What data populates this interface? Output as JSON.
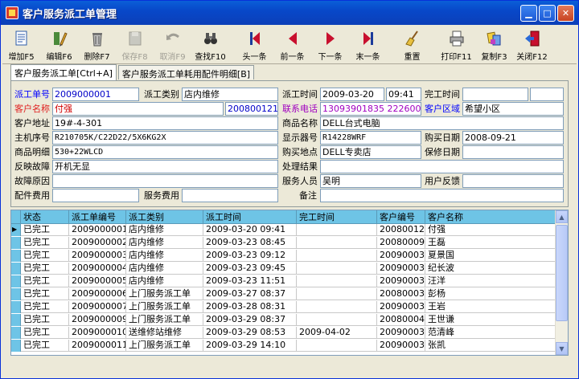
{
  "window": {
    "title": "客户服务派工单管理"
  },
  "toolbar": [
    {
      "key": "add",
      "label": "增加F5",
      "icon": "document-add-icon",
      "disabled": false
    },
    {
      "key": "edit",
      "label": "编辑F6",
      "icon": "edit-pencil-icon",
      "disabled": false
    },
    {
      "key": "delete",
      "label": "删除F7",
      "icon": "trash-icon",
      "disabled": false
    },
    {
      "key": "save",
      "label": "保存F8",
      "icon": "save-icon",
      "disabled": true
    },
    {
      "key": "cancel",
      "label": "取消F9",
      "icon": "undo-icon",
      "disabled": true
    },
    {
      "key": "find",
      "label": "查找F10",
      "icon": "binoculars-icon",
      "disabled": false
    },
    {
      "key": "first",
      "label": "头一条",
      "icon": "first-record-icon",
      "disabled": false
    },
    {
      "key": "prev",
      "label": "前一条",
      "icon": "prev-record-icon",
      "disabled": false
    },
    {
      "key": "next",
      "label": "下一条",
      "icon": "next-record-icon",
      "disabled": false
    },
    {
      "key": "last",
      "label": "末一条",
      "icon": "last-record-icon",
      "disabled": false
    },
    {
      "key": "reset",
      "label": "重置",
      "icon": "broom-icon",
      "disabled": false
    },
    {
      "key": "print",
      "label": "打印F11",
      "icon": "printer-icon",
      "disabled": false
    },
    {
      "key": "copy",
      "label": "复制F3",
      "icon": "copy-icon",
      "disabled": false
    },
    {
      "key": "close",
      "label": "关闭F12",
      "icon": "exit-door-icon",
      "disabled": false
    }
  ],
  "tabs": [
    {
      "label": "客户服务派工单[Ctrl+A]"
    },
    {
      "label": "客户服务派工单耗用配件明细[B]"
    }
  ],
  "form": {
    "order_no_label": "派工单号",
    "order_no": "2009000001",
    "order_type_label": "派工类别",
    "order_type": "店内维修",
    "dispatch_time_label": "派工时间",
    "dispatch_date": "2009-03-20",
    "dispatch_clock": "09:41",
    "finish_time_label": "完工时间",
    "finish_time": "",
    "customer_name_label": "客户名称",
    "customer_name": "付强",
    "customer_no": "2008001210",
    "phone_label": "联系电话",
    "phone": "13093901835   2226005",
    "region_label": "客户区域",
    "region": "希望小区",
    "address_label": "客户地址",
    "address": "19#-4-301",
    "product_label": "商品名称",
    "product": "DELL台式电脑",
    "host_sn_label": "主机序号",
    "host_sn": "R210705K/C22D22/5X6KG2X",
    "display_sn_label": "显示器号",
    "display_sn": "R14228WRF",
    "buy_date_label": "购买日期",
    "buy_date": "2008-09-21",
    "product_detail_label": "商品明细",
    "product_detail": "530+22WLCD",
    "buy_place_label": "购买地点",
    "buy_place": "DELL专卖店",
    "warranty_label": "保修日期",
    "warranty": "",
    "fault_label": "反映故障",
    "fault": "开机无显",
    "result_label": "处理结果",
    "result": "",
    "fault_reason_label": "故障原因",
    "fault_reason": "",
    "staff_label": "服务人员",
    "staff": "吴明",
    "feedback_label": "用户反馈",
    "feedback": "",
    "parts_fee_label": "配件费用",
    "parts_fee": "",
    "service_fee_label": "服务费用",
    "service_fee": "",
    "remark_label": "备注",
    "remark": ""
  },
  "grid": {
    "columns": [
      "状态",
      "派工单编号",
      "派工类别",
      "派工时间",
      "完工时间",
      "客户编号",
      "客户名称"
    ],
    "rows": [
      [
        "已完工",
        "2009000001",
        "店内维修",
        "2009-03-20 09:41",
        "",
        "2008001210",
        "付强"
      ],
      [
        "已完工",
        "2009000002",
        "店内维修",
        "2009-03-23 08:45",
        "",
        "2008000952",
        "王磊"
      ],
      [
        "已完工",
        "2009000003",
        "店内维修",
        "2009-03-23 09:12",
        "",
        "2009000321",
        "夏景国"
      ],
      [
        "已完工",
        "2009000004",
        "店内维修",
        "2009-03-23 09:45",
        "",
        "2009000323",
        "纪长波"
      ],
      [
        "已完工",
        "2009000005",
        "店内维修",
        "2009-03-23 11:51",
        "",
        "2009000324",
        "汪洋"
      ],
      [
        "已完工",
        "2009000006",
        "上门服务派工单",
        "2009-03-27 08:37",
        "",
        "2008000399",
        "彭杨"
      ],
      [
        "已完工",
        "2009000007",
        "上门服务派工单",
        "2009-03-28 08:31",
        "",
        "2009000331",
        "王岩"
      ],
      [
        "已完工",
        "2009000009",
        "上门服务派工单",
        "2009-03-29 08:37",
        "",
        "2008000409",
        "王世谦"
      ],
      [
        "已完工",
        "2009000010",
        "送维修站维修",
        "2009-03-29 08:53",
        "2009-04-02",
        "2009000349",
        "范清峰"
      ],
      [
        "已完工",
        "2009000011",
        "上门服务派工单",
        "2009-03-29 14:10",
        "",
        "2009000350",
        "张凯"
      ]
    ]
  }
}
